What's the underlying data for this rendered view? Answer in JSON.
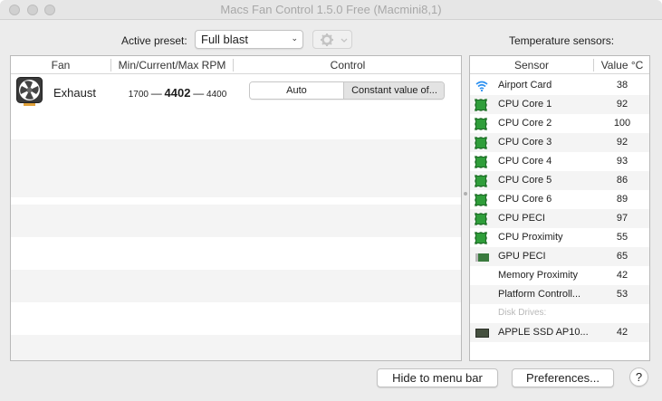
{
  "window": {
    "title": "Macs Fan Control 1.5.0 Free (Macmini8,1)"
  },
  "preset": {
    "label": "Active preset:",
    "value": "Full blast"
  },
  "sensors_heading": "Temperature sensors:",
  "fans_table": {
    "headers": [
      "Fan",
      "Min/Current/Max RPM",
      "Control"
    ],
    "rows": [
      {
        "name": "Exhaust",
        "min": "1700",
        "current": "4402",
        "max": "4400",
        "sep": "—",
        "control_auto": "Auto",
        "control_constant": "Constant value of..."
      }
    ]
  },
  "sensors_table": {
    "headers": [
      "Sensor",
      "Value °C"
    ],
    "rows": [
      {
        "name": "Airport Card",
        "value": "38",
        "icon": "wifi-icon"
      },
      {
        "name": "CPU Core 1",
        "value": "92",
        "icon": "cpu-chip-icon"
      },
      {
        "name": "CPU Core 2",
        "value": "100",
        "icon": "cpu-chip-icon"
      },
      {
        "name": "CPU Core 3",
        "value": "92",
        "icon": "cpu-chip-icon"
      },
      {
        "name": "CPU Core 4",
        "value": "93",
        "icon": "cpu-chip-icon"
      },
      {
        "name": "CPU Core 5",
        "value": "86",
        "icon": "cpu-chip-icon"
      },
      {
        "name": "CPU Core 6",
        "value": "89",
        "icon": "cpu-chip-icon"
      },
      {
        "name": "CPU PECI",
        "value": "97",
        "icon": "cpu-chip-icon"
      },
      {
        "name": "CPU Proximity",
        "value": "55",
        "icon": "cpu-chip-icon"
      },
      {
        "name": "GPU PECI",
        "value": "65",
        "icon": "gpu-card-icon"
      },
      {
        "name": "Memory Proximity",
        "value": "42",
        "icon": ""
      },
      {
        "name": "Platform Controll...",
        "value": "53",
        "icon": ""
      }
    ],
    "disk_section": "Disk Drives:",
    "disk_rows": [
      {
        "name": "APPLE SSD AP10...",
        "value": "42",
        "icon": "ssd-drive-icon"
      }
    ]
  },
  "footer": {
    "hide_button": "Hide to menu bar",
    "preferences_button": "Preferences...",
    "help_button": "?"
  },
  "colors": {
    "chip": "#2f9e3a",
    "wifi": "#2a8ff0",
    "stripe": "#f4f4f4"
  }
}
